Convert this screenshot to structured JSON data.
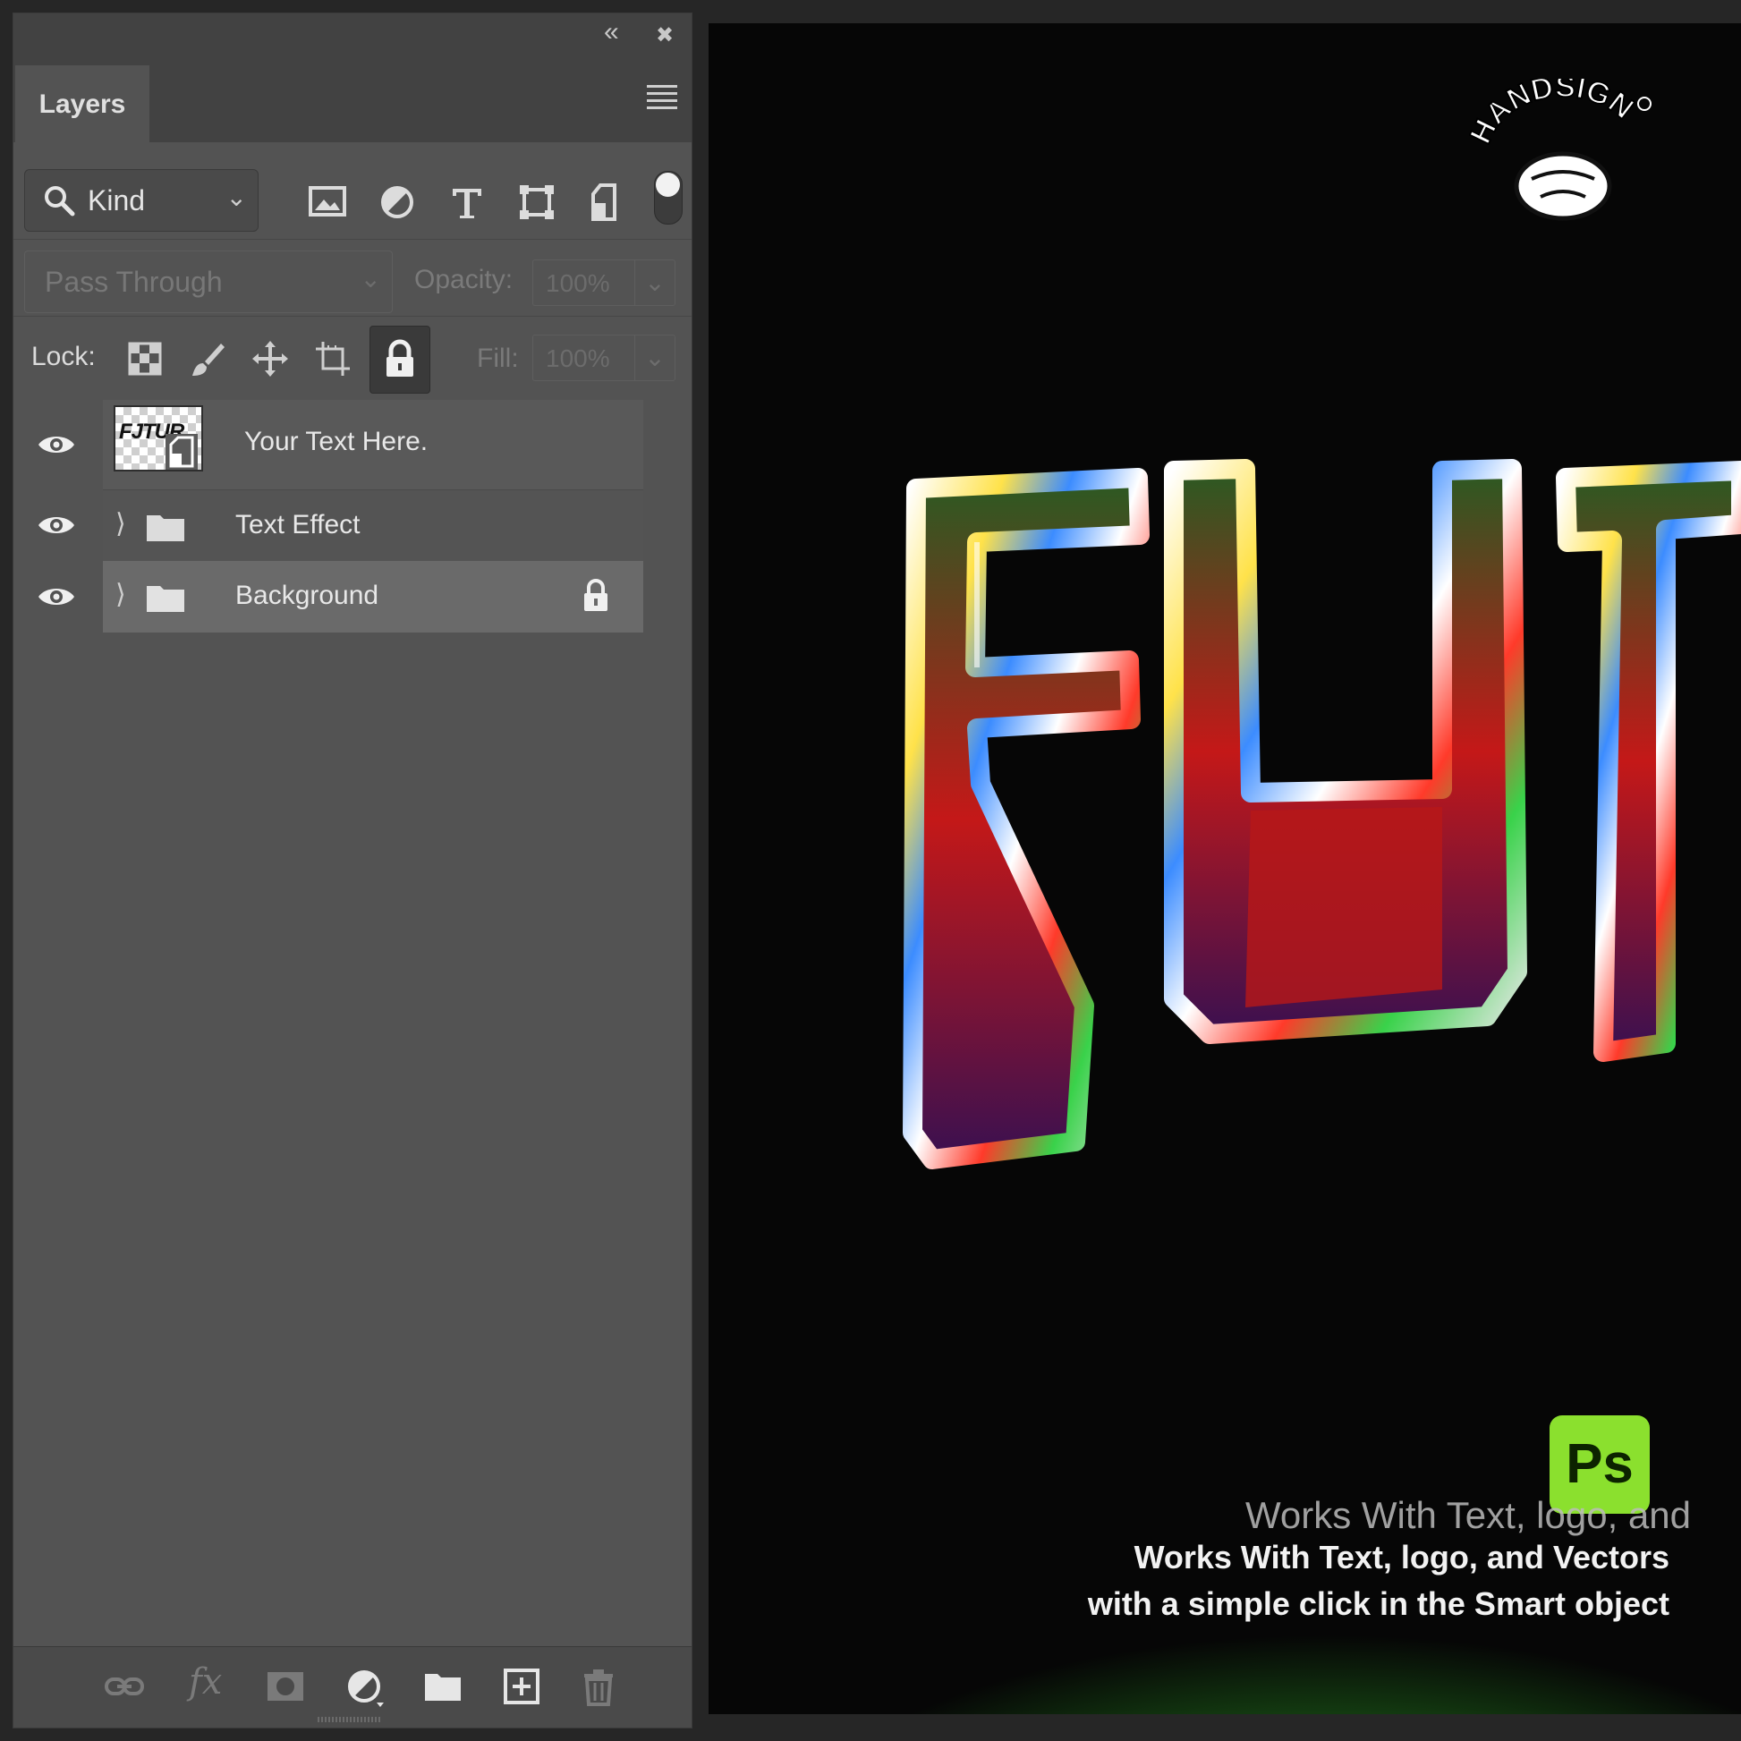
{
  "panel": {
    "tab_label": "Layers",
    "collapse_glyph": "«",
    "close_glyph": "✖"
  },
  "filter": {
    "kind_label": "Kind",
    "icons": [
      "image-filter-icon",
      "adjustment-filter-icon",
      "type-filter-icon",
      "shape-filter-icon",
      "smart-object-filter-icon"
    ]
  },
  "blend": {
    "mode": "Pass Through",
    "opacity_label": "Opacity:",
    "opacity_value": "100%"
  },
  "lock": {
    "label": "Lock:",
    "fill_label": "Fill:",
    "fill_value": "100%"
  },
  "layers": [
    {
      "name": "Your Text Here.",
      "type": "smart-object",
      "visible": true,
      "locked": false,
      "thumb_text": "FJTUR"
    },
    {
      "name": "Text Effect",
      "type": "group",
      "visible": true,
      "locked": false
    },
    {
      "name": "Background",
      "type": "group",
      "visible": true,
      "locked": true,
      "selected": true
    }
  ],
  "bottom_icons": [
    "link-icon",
    "fx-icon",
    "mask-icon",
    "adjustment-layer-icon",
    "new-group-icon",
    "new-layer-icon",
    "trash-icon"
  ],
  "bottom_fx_label": "fx",
  "canvas": {
    "logo_text": "HANDSIGN",
    "ps_badge": "Ps",
    "tagline_ghost": "Works With Text, logo, and",
    "tagline_line1": "Works With Text, logo, and Vectors",
    "tagline_line2": "with a simple click in the Smart object",
    "colors": {
      "background": "#060606",
      "glow": "#3fa830",
      "badge": "#8be02e"
    }
  }
}
